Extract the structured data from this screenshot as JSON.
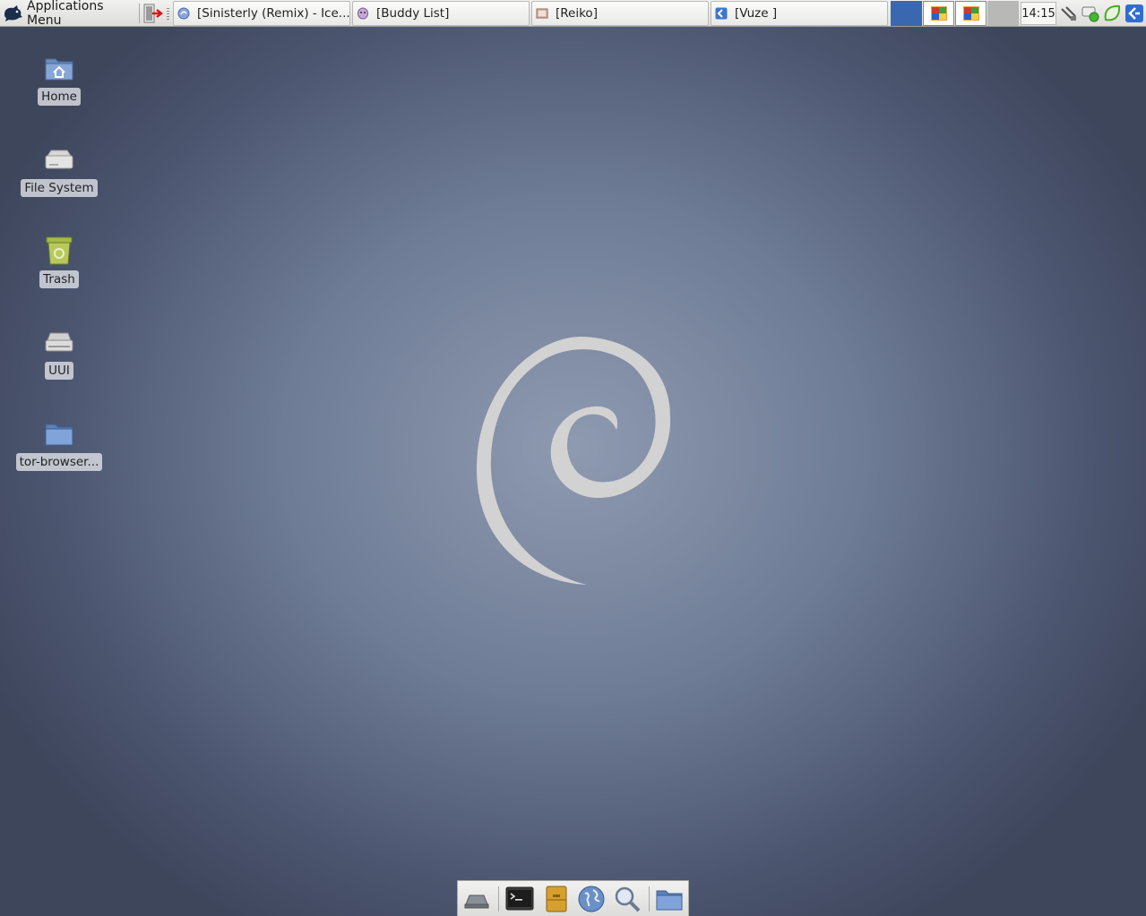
{
  "panel": {
    "app_menu_label": "Applications Menu",
    "clock": "14:15",
    "tasks": [
      {
        "label": "[Sinisterly (Remix) - Ice...",
        "icon": "iceweasel-icon"
      },
      {
        "label": "[Buddy List]",
        "icon": "pidgin-icon"
      },
      {
        "label": "[Reiko]",
        "icon": "chat-window-icon"
      },
      {
        "label": "[Vuze   ]",
        "icon": "vuze-icon"
      }
    ],
    "workspaces": [
      "workspace-1",
      "workspace-2",
      "workspace-3",
      "workspace-4"
    ],
    "tray": [
      "network-icon",
      "pidgin-status-icon",
      "leaf-icon",
      "vuze-tray-icon"
    ]
  },
  "desktop": {
    "icons": [
      {
        "label": "Home",
        "icon": "home-folder-icon"
      },
      {
        "label": "File System",
        "icon": "drive-icon"
      },
      {
        "label": "Trash",
        "icon": "trash-icon"
      },
      {
        "label": "UUI",
        "icon": "removable-drive-icon"
      },
      {
        "label": "tor-browser...",
        "icon": "folder-icon"
      }
    ],
    "wallpaper": "debian-swirl",
    "colors": {
      "wallpaper_center": "#8e9ab0",
      "wallpaper_edge": "#3e465c",
      "swirl": "#d2d2d2"
    }
  },
  "dock": {
    "items": [
      "show-desktop-icon",
      "terminal-icon",
      "file-cabinet-icon",
      "web-browser-icon",
      "search-icon",
      "folder-icon"
    ]
  }
}
